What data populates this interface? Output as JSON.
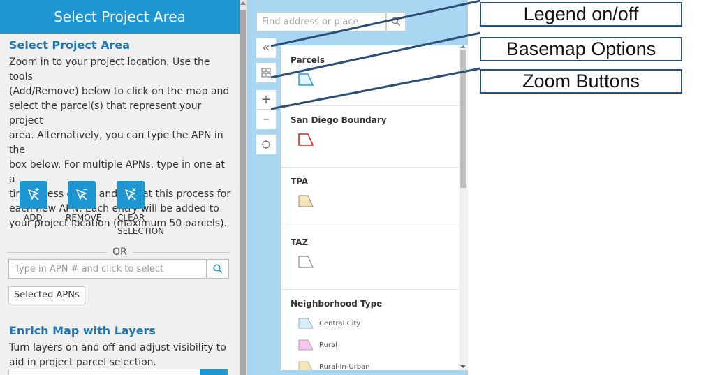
{
  "left_panel": {
    "header_title": "Select Project Area",
    "heading1": "Select Project Area",
    "intro_lines": [
      "Zoom in to your project location. Use the tools",
      "(Add/Remove) below to click on the map and",
      "select the parcel(s) that represent your project",
      "area. Alternatively, you can type the APN in the",
      "box below. For multiple APNs, type in one at a",
      "time, press enter, and repeat this process for",
      "each new APN. Each entry will be added to",
      "your project location (maximum 50 parcels)."
    ],
    "tools": [
      {
        "label_lines": [
          "ADD"
        ],
        "icon": "cursor-add-icon"
      },
      {
        "label_lines": [
          "REMOVE"
        ],
        "icon": "cursor-remove-icon"
      },
      {
        "label_lines": [
          "CLEAR",
          "SELECTION"
        ],
        "icon": "cursor-clear-icon"
      }
    ],
    "or_text": "OR",
    "apn_input": {
      "placeholder": "Type in APN # and click to select",
      "value": ""
    },
    "selected_apns_label": "Selected APNs",
    "heading2": "Enrich Map with Layers",
    "enrich_lines": [
      "Turn layers on and off and adjust visibility to",
      "aid in project parcel selection."
    ]
  },
  "map": {
    "search": {
      "placeholder": "Find address or place",
      "value": ""
    },
    "buttons": [
      {
        "name": "legend-toggle",
        "glyph": "«"
      },
      {
        "name": "basemap",
        "icon": "basemap-grid-icon"
      },
      {
        "name": "zoom-in",
        "glyph": "+"
      },
      {
        "name": "zoom-out",
        "glyph": "–"
      },
      {
        "name": "locate",
        "icon": "crosshair-icon"
      }
    ],
    "legend": {
      "sections": [
        {
          "title": "Parcels",
          "color": "#a8dcf2",
          "stroke": "#1ea0dc"
        },
        {
          "title": "San Diego Boundary",
          "color": "#ffffff",
          "stroke": "#e02020"
        },
        {
          "title": "TPA",
          "color": "#f5e3b8",
          "stroke": "#9b9b9b"
        },
        {
          "title": "TAZ",
          "color": "#ffffff",
          "stroke": "#8a8a8a"
        },
        {
          "title": "Neighborhood Type",
          "items": [
            {
              "label": "Central City",
              "color": "#d6eef8"
            },
            {
              "label": "Rural",
              "color": "#f6c8f0"
            },
            {
              "label": "Rural-In-Urban",
              "color": "#f7e6b8"
            }
          ]
        }
      ]
    }
  },
  "annotations": [
    {
      "label": "Legend on/off"
    },
    {
      "label": "Basemap Options"
    },
    {
      "label": "Zoom Buttons"
    }
  ],
  "colors": {
    "accent": "#1e96d2",
    "heading": "#1f78b4",
    "map_bg": "#a9d6f1",
    "annotation_border": "#2c4f75"
  }
}
